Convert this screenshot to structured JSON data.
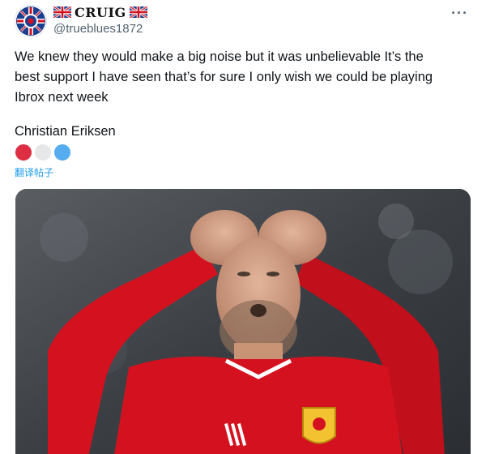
{
  "account": {
    "display_name": "CRUIG",
    "handle": "@trueblues1872",
    "avatar_icon": "rangers-crest-icon",
    "flag_icon": "union-jack-flag-icon"
  },
  "menu": {
    "more_label": "···"
  },
  "tweet": {
    "lines": [
      "We knew they would make a big noise but it was unbelievable It’s the",
      "best support I have seen that’s for sure I only wish we could be playing",
      "Ibrox next week"
    ],
    "signoff": "Christian Eriksen",
    "emoji_dots": [
      {
        "name": "red-circle-icon",
        "color": "#dd2e44"
      },
      {
        "name": "white-circle-icon",
        "color": "#e6e7e8"
      },
      {
        "name": "blue-circle-icon",
        "color": "#55acee"
      }
    ],
    "translate_label": "翻译帖子"
  },
  "media": {
    "kind": "photo",
    "colors": {
      "shirt": "#d4121f",
      "background": "#3a3e45"
    }
  }
}
